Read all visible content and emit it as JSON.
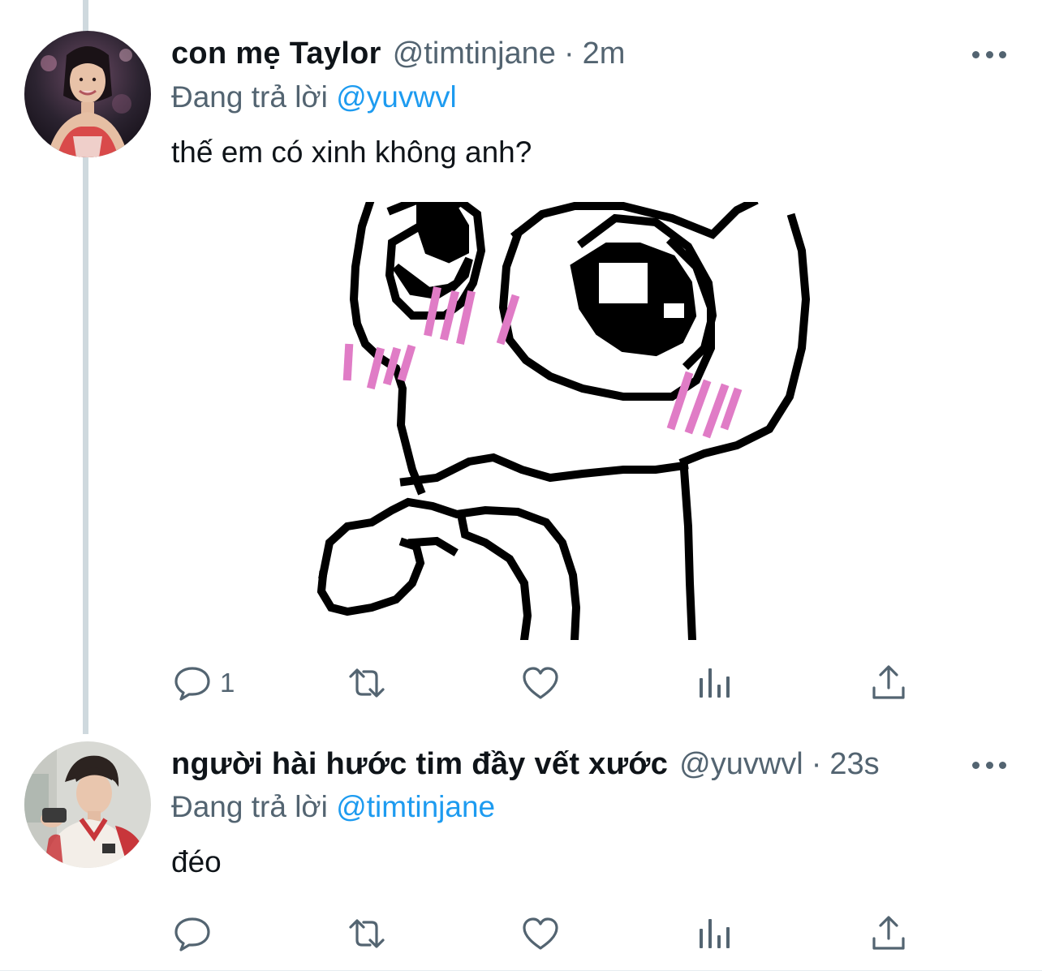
{
  "colors": {
    "text": "#0f1419",
    "secondary": "#536471",
    "accent": "#1d9bf0",
    "thread_line": "#cfd9de",
    "blush": "#e07cc6"
  },
  "tweets": [
    {
      "display_name": "con mẹ Taylor",
      "handle": "@timtinjane",
      "separator": "·",
      "time": "2m",
      "reply_prefix": "Đang trả lời",
      "reply_mention": "@yuvwvl",
      "text": "thế em có xinh không anh?",
      "media_icon": "pixel-art-meme-face",
      "actions": {
        "reply_icon": "reply-icon",
        "reply_count": "1",
        "retweet_icon": "retweet-icon",
        "like_icon": "heart-icon",
        "stats_icon": "bar-chart-icon",
        "share_icon": "share-icon"
      }
    },
    {
      "display_name": "người hài hước tim đầy vết xước",
      "handle": "@yuvwvl",
      "separator": "·",
      "time": "23s",
      "reply_prefix": "Đang trả lời",
      "reply_mention": "@timtinjane",
      "text": "đéo",
      "actions": {
        "reply_icon": "reply-icon",
        "reply_count": "",
        "retweet_icon": "retweet-icon",
        "like_icon": "heart-icon",
        "stats_icon": "bar-chart-icon",
        "share_icon": "share-icon"
      }
    }
  ]
}
